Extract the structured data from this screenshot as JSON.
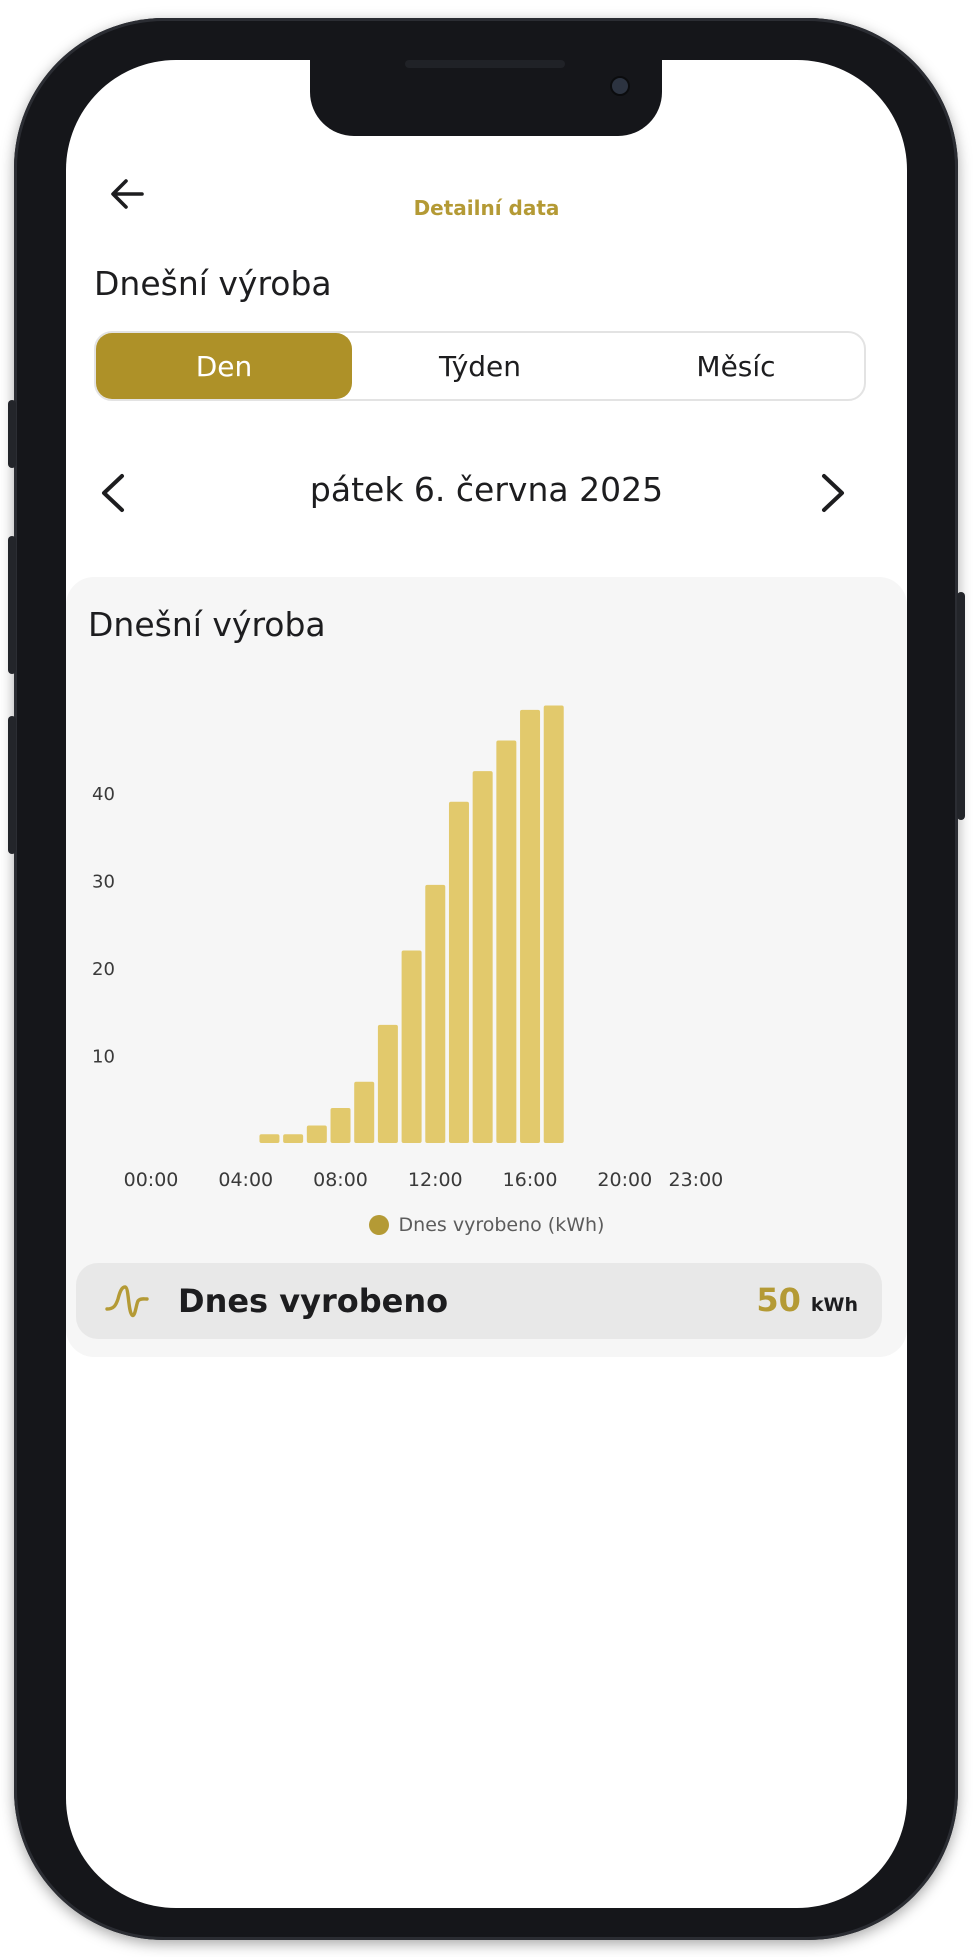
{
  "header": {
    "title": "Detailní data"
  },
  "section_title": "Dnešní výroba",
  "period_tabs": [
    {
      "label": "Den",
      "active": true
    },
    {
      "label": "Týden",
      "active": false
    },
    {
      "label": "Měsíc",
      "active": false
    }
  ],
  "date_nav": {
    "date_text": "pátek 6. června 2025"
  },
  "card": {
    "title": "Dnešní výroba"
  },
  "chart_data": {
    "type": "bar",
    "x_tick_labels": [
      "00:00",
      "04:00",
      "08:00",
      "12:00",
      "16:00",
      "20:00",
      "23:00"
    ],
    "x_tick_hours": [
      0,
      4,
      8,
      12,
      16,
      20,
      23
    ],
    "hours": [
      5,
      6,
      7,
      8,
      9,
      10,
      11,
      12,
      13,
      14,
      15,
      16,
      17
    ],
    "values": [
      1,
      1,
      2,
      4,
      7,
      13.5,
      22,
      29.5,
      39,
      42.5,
      46,
      49.5,
      50
    ],
    "y_ticks": [
      10,
      20,
      30,
      40
    ],
    "ylim": [
      0,
      52
    ],
    "series_name": "Dnes vyrobeno (kWh)",
    "color": "#e2c96c",
    "legend_color": "#b49a35",
    "grid": false
  },
  "summary": {
    "label": "Dnes vyrobeno",
    "value": "50",
    "unit": "kWh"
  },
  "colors": {
    "accent": "#ae9128",
    "accent_text": "#b49a35",
    "bar": "#e2c96c"
  },
  "icons": {
    "back": "arrow-left-icon",
    "prev": "chevron-left-icon",
    "next": "chevron-right-icon",
    "production": "wave-icon"
  }
}
